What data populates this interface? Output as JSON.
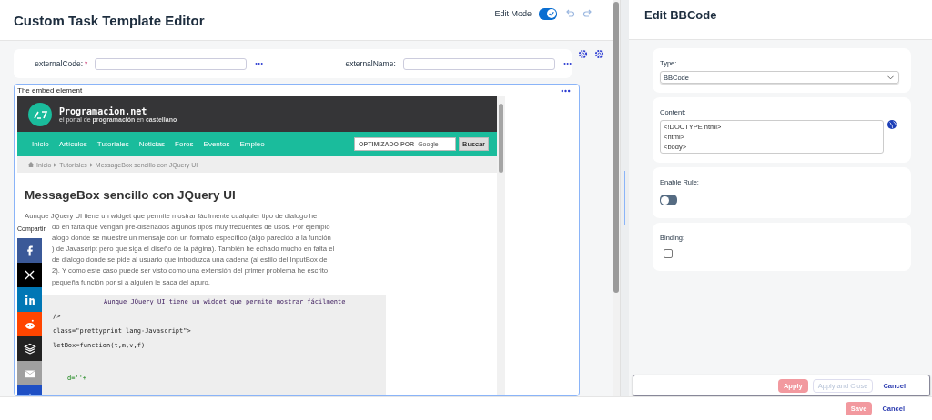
{
  "editor": {
    "title": "Custom Task Template Editor",
    "edit_mode_label": "Edit Mode",
    "edit_mode_on": true
  },
  "fields": [
    {
      "label": "externalCode:",
      "required_mark": "*"
    },
    {
      "label": "externalName:"
    }
  ],
  "embed": {
    "label": "The embed element",
    "site": {
      "name": "Programacion.net",
      "tagline": "el portal de **programación** en **castellano**",
      "nav": [
        "Inicio",
        "Artículos",
        "Tutoriales",
        "Noticias",
        "Foros",
        "Eventos",
        "Empleo"
      ],
      "search_hint": "OPTIMIZADO POR",
      "search_brand": "Google",
      "search_button": "Buscar",
      "breadcrumb": [
        "Inicio",
        "Tutoriales",
        "MessageBox sencillo con JQuery UI"
      ],
      "heading": "MessageBox sencillo con JQuery UI",
      "paragraph_lines": [
        "Aunque JQuery UI tiene un widget que permite mostrar fácilmente cualquier tipo de dialogo he",
        "do en falta que vengan pre-diseñados algunos tipos muy frecuentes de usos. Por ejemplo",
        "alogo donde se muestre un mensaje con un formato específico (algo parecido a la función",
        ") de Javascript pero que siga el diseño de la página). También he echado mucho en falta el",
        "de dialogo donde se pide al usuario que introduzca una cadena (al estilo del InputBox de",
        "2). Y como este caso puede ser visto como una extensión del primer problema he escrito",
        "pequeña función por si a alguien le saca del apuro."
      ],
      "code_lines": [
        {
          "text": "Aunque JQuery UI tiene un widget que permite mostrar fácilmente",
          "kind": "comment"
        },
        {
          "text": "/>",
          "kind": "plain"
        },
        {
          "text": "class=\"prettyprint lang-Javascript\">",
          "kind": "plain"
        },
        {
          "text": "letBox=function(t,m,v,f)",
          "kind": "plain"
        },
        {
          "text": "d=''+",
          "kind": "indent"
        }
      ],
      "share_label": "Compartir",
      "share": [
        {
          "kind": "facebook",
          "color": "#3b5998"
        },
        {
          "kind": "x",
          "color": "#000000"
        },
        {
          "kind": "linkedin",
          "color": "#0077b5"
        },
        {
          "kind": "reddit",
          "color": "#ff4500"
        },
        {
          "kind": "buffer",
          "color": "#222222"
        },
        {
          "kind": "email",
          "color": "#a0a0a0"
        },
        {
          "kind": "more",
          "color": "#1e4fc4"
        }
      ]
    }
  },
  "panel": {
    "title": "Edit BBCode",
    "type": {
      "label": "Type:",
      "value": "BBCode"
    },
    "content": {
      "label": "Content:",
      "lines": [
        "<!DOCTYPE html>",
        "<html>",
        "<body>"
      ]
    },
    "enable_rule": {
      "label": "Enable Rule:",
      "on": false
    },
    "binding": {
      "label": "Binding:",
      "checked": false
    },
    "buttons": [
      {
        "label": "Apply",
        "kind": "primary",
        "disabled": true
      },
      {
        "label": "Apply and Close",
        "kind": "secondary",
        "disabled": true
      },
      {
        "label": "Cancel",
        "kind": "link",
        "disabled": false
      }
    ]
  },
  "footer": {
    "buttons": [
      {
        "label": "Save",
        "kind": "primary",
        "disabled": true
      },
      {
        "label": "Cancel",
        "kind": "link",
        "disabled": false
      }
    ]
  }
}
